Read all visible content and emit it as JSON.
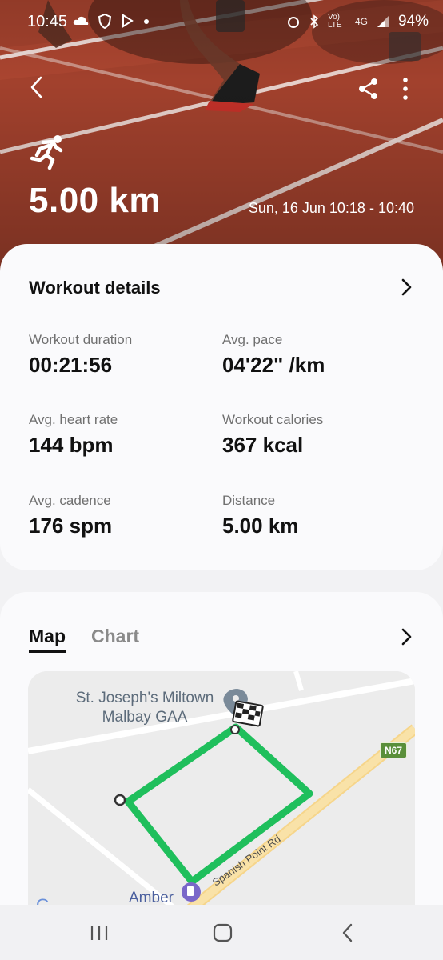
{
  "status_bar": {
    "time": "10:45",
    "battery": "94%",
    "network": "4G",
    "volte": "Vo) LTE",
    "left_icons": [
      "cloud-icon",
      "shield-icon",
      "play-icon",
      "dot-icon"
    ],
    "right_icons": [
      "alarm-icon",
      "bluetooth-icon",
      "signal-icon"
    ]
  },
  "hero": {
    "activity_icon": "running-icon",
    "distance": "5.00 km",
    "date_range": "Sun, 16 Jun 10:18 - 10:40",
    "colors": {
      "track": "#a4432f",
      "lines": "#f3e9e6"
    }
  },
  "details": {
    "title": "Workout details",
    "stats": [
      {
        "label": "Workout duration",
        "value": "00:21:56"
      },
      {
        "label": "Avg. pace",
        "value": "04'22\" /km"
      },
      {
        "label": "Avg. heart rate",
        "value": "144 bpm"
      },
      {
        "label": "Workout calories",
        "value": "367 kcal"
      },
      {
        "label": "Avg. cadence",
        "value": "176 spm"
      },
      {
        "label": "Distance",
        "value": "5.00 km"
      }
    ]
  },
  "map_section": {
    "tabs": [
      {
        "label": "Map",
        "active": true
      },
      {
        "label": "Chart",
        "active": false
      }
    ],
    "place_name": "St. Joseph's Miltown Malbay GAA",
    "road_badge": "N67",
    "road_name": "Spanish Point Rd",
    "poi_name": "Amber",
    "route_color": "#1fbf5c"
  },
  "nav": {
    "recents": "recents-icon",
    "home": "home-icon",
    "back": "back-icon"
  }
}
